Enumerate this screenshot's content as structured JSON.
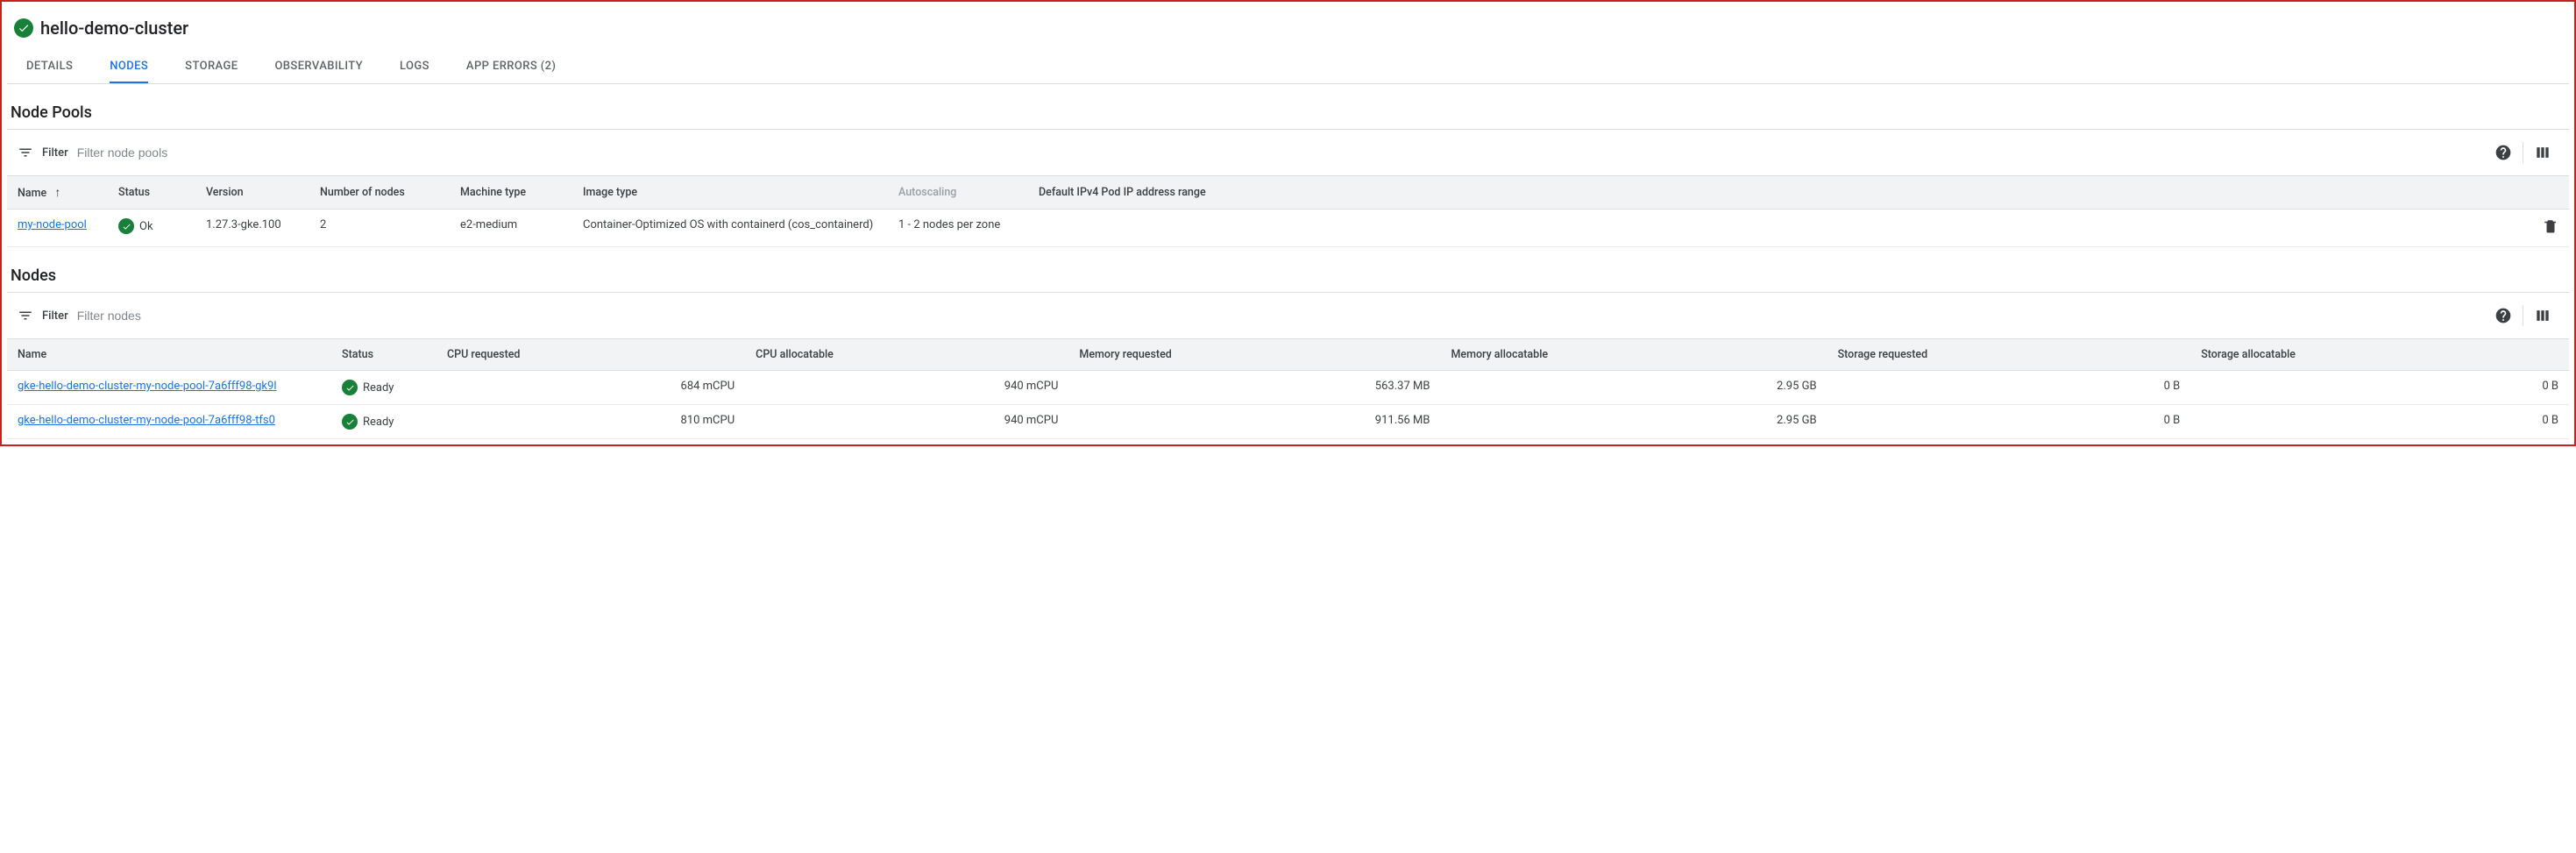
{
  "header": {
    "cluster_name": "hello-demo-cluster"
  },
  "tabs": [
    {
      "label": "DETAILS",
      "active": false
    },
    {
      "label": "NODES",
      "active": true
    },
    {
      "label": "STORAGE",
      "active": false
    },
    {
      "label": "OBSERVABILITY",
      "active": false
    },
    {
      "label": "LOGS",
      "active": false
    },
    {
      "label": "APP ERRORS (2)",
      "active": false
    }
  ],
  "node_pools_section": {
    "title": "Node Pools",
    "filter_label": "Filter",
    "filter_placeholder": "Filter node pools",
    "columns": {
      "name": "Name",
      "status": "Status",
      "version": "Version",
      "num_nodes": "Number of nodes",
      "machine_type": "Machine type",
      "image_type": "Image type",
      "autoscaling": "Autoscaling",
      "pod_range": "Default IPv4 Pod IP address range"
    },
    "rows": [
      {
        "name": "my-node-pool",
        "status": "Ok",
        "version": "1.27.3-gke.100",
        "num_nodes": "2",
        "machine_type": "e2-medium",
        "image_type": "Container-Optimized OS with containerd (cos_containerd)",
        "autoscaling": "1 - 2 nodes per zone",
        "pod_range": ""
      }
    ]
  },
  "nodes_section": {
    "title": "Nodes",
    "filter_label": "Filter",
    "filter_placeholder": "Filter nodes",
    "columns": {
      "name": "Name",
      "status": "Status",
      "cpu_req": "CPU requested",
      "cpu_alloc": "CPU allocatable",
      "mem_req": "Memory requested",
      "mem_alloc": "Memory allocatable",
      "stor_req": "Storage requested",
      "stor_alloc": "Storage allocatable"
    },
    "rows": [
      {
        "name": "gke-hello-demo-cluster-my-node-pool-7a6fff98-gk9l",
        "status": "Ready",
        "cpu_req": "684 mCPU",
        "cpu_alloc": "940 mCPU",
        "mem_req": "563.37 MB",
        "mem_alloc": "2.95 GB",
        "stor_req": "0 B",
        "stor_alloc": "0 B"
      },
      {
        "name": "gke-hello-demo-cluster-my-node-pool-7a6fff98-tfs0",
        "status": "Ready",
        "cpu_req": "810 mCPU",
        "cpu_alloc": "940 mCPU",
        "mem_req": "911.56 MB",
        "mem_alloc": "2.95 GB",
        "stor_req": "0 B",
        "stor_alloc": "0 B"
      }
    ]
  }
}
